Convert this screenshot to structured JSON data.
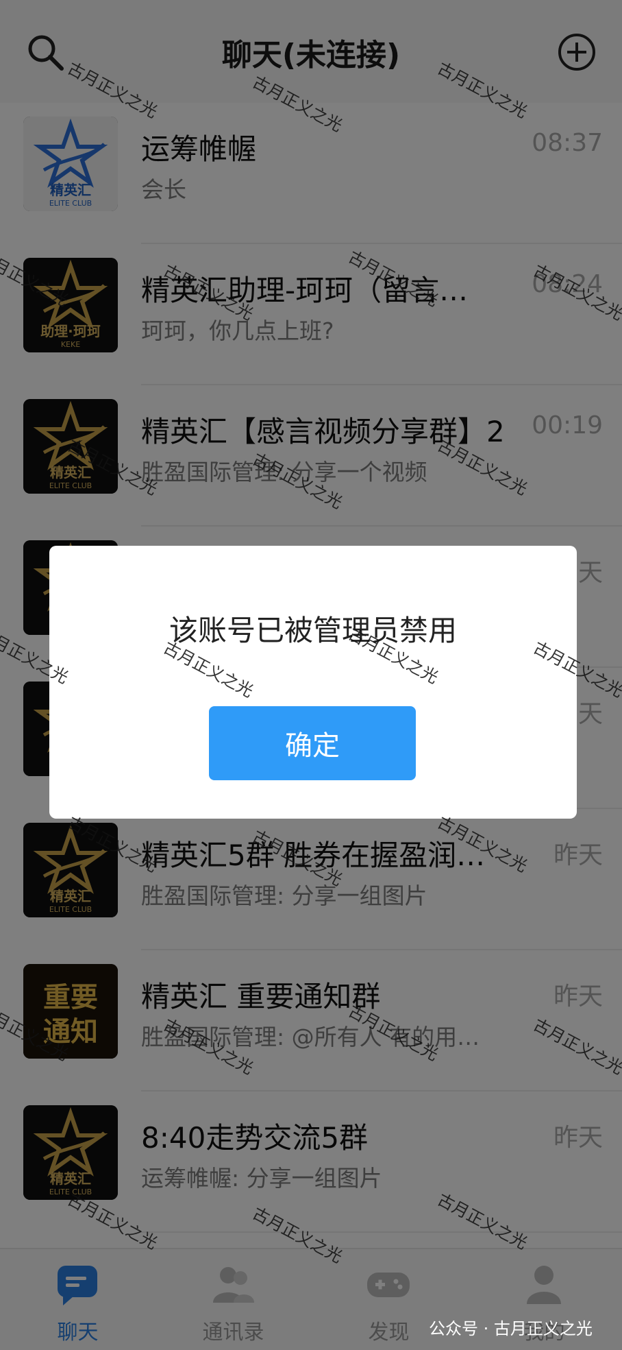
{
  "header": {
    "title": "聊天(未连接)",
    "search_icon": "search-icon",
    "add_icon": "add-circle-icon"
  },
  "chats": [
    {
      "name": "运筹帷幄",
      "preview": "会长",
      "time": "08:37",
      "avatar": {
        "style": "light",
        "line1": "精英汇",
        "line2": "ELITE CLUB"
      }
    },
    {
      "name": "精英汇助理-珂珂（留言…",
      "preview": "珂珂，你几点上班?",
      "time": "08:24",
      "avatar": {
        "style": "dark",
        "line1": "助理·珂珂",
        "line2": "KEKE"
      }
    },
    {
      "name": "精英汇【感言视频分享群】2",
      "preview": "胜盈国际管理: 分享一个视频",
      "time": "00:19",
      "avatar": {
        "style": "dark",
        "line1": "精英汇",
        "line2": "ELITE CLUB"
      }
    },
    {
      "name": "",
      "preview": "",
      "time": "天",
      "avatar": {
        "style": "dark",
        "line1": "",
        "line2": ""
      }
    },
    {
      "name": "",
      "preview": "",
      "time": "天",
      "avatar": {
        "style": "dark",
        "line1": "",
        "line2": ""
      }
    },
    {
      "name": "精英汇5群 胜券在握盈润…",
      "preview": "胜盈国际管理: 分享一组图片",
      "time": "昨天",
      "avatar": {
        "style": "dark",
        "line1": "精英汇",
        "line2": "ELITE CLUB"
      }
    },
    {
      "name": "精英汇 重要通知群",
      "preview": "胜盈国际管理: @所有人 有的用…",
      "time": "昨天",
      "avatar": {
        "style": "notice",
        "line1": "重要",
        "line2": "通知"
      }
    },
    {
      "name": "8:40走势交流5群",
      "preview": "运筹帷幄: 分享一组图片",
      "time": "昨天",
      "avatar": {
        "style": "dark",
        "line1": "精英汇",
        "line2": "ELITE CLUB"
      }
    }
  ],
  "tabs": [
    {
      "label": "聊天",
      "icon": "chat-icon",
      "active": true
    },
    {
      "label": "通讯录",
      "icon": "contacts-icon",
      "active": false
    },
    {
      "label": "发现",
      "icon": "gamepad-icon",
      "active": false
    },
    {
      "label": "我的",
      "icon": "profile-icon",
      "active": false
    }
  ],
  "dialog": {
    "message": "该账号已被管理员禁用",
    "ok_label": "确定"
  },
  "watermark": {
    "text": "古月正义之光",
    "mp_tag": "公众号 · 古月正义之光"
  },
  "colors": {
    "accent": "#2f9bf8",
    "tab_active": "#2b7fe0",
    "overlay": "rgba(0,0,0,0.5)"
  }
}
